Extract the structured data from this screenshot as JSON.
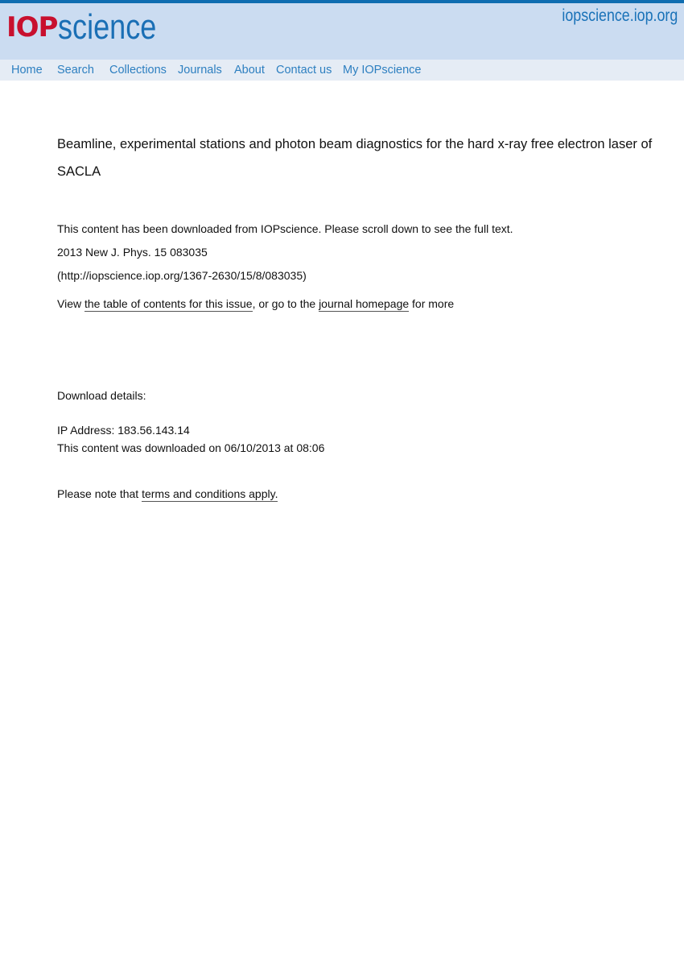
{
  "header": {
    "logo_iop": "IOP",
    "logo_science": "science",
    "site_url": "iopscience.iop.org"
  },
  "nav": {
    "items": [
      {
        "label": "Home"
      },
      {
        "label": "Search"
      },
      {
        "label": "Collections"
      },
      {
        "label": "Journals"
      },
      {
        "label": "About"
      },
      {
        "label": "Contact us"
      },
      {
        "label": "My IOPscience"
      }
    ]
  },
  "article": {
    "title": "Beamline, experimental stations and photon beam diagnostics for the hard x-ray free electron laser of SACLA",
    "download_notice": "This content has been downloaded from IOPscience. Please scroll down to see the full text.",
    "citation": "2013 New J. Phys. 15 083035",
    "url": "(http://iopscience.iop.org/1367-2630/15/8/083035)",
    "view_prefix": "View ",
    "toc_link": "the table of contents for this issue",
    "view_middle": ", or go to the ",
    "journal_link": "journal homepage",
    "view_suffix": " for more"
  },
  "download_details": {
    "heading": "Download details:",
    "ip_address": "IP Address: 183.56.143.14",
    "downloaded_on": "This content was downloaded on 06/10/2013 at 08:06",
    "note_prefix": "Please note that ",
    "terms_link": "terms and conditions apply."
  }
}
